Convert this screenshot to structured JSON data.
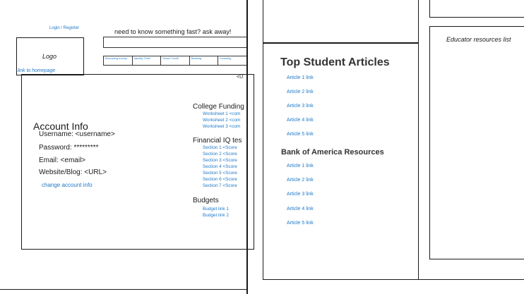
{
  "header": {
    "login": "Login / Register",
    "ask_label": "need to know something fast? ask away!",
    "logo": "Logo",
    "home_link": "link to homepage"
  },
  "nav": [
    {
      "label": "Borrowing money"
    },
    {
      "label": "Identity Theft"
    },
    {
      "label": "Smart Credit"
    },
    {
      "label": "Banking"
    },
    {
      "label": "Investing"
    }
  ],
  "url_tag": "<U",
  "account": {
    "heading": "Account Info",
    "username": "Username: <username>",
    "password": "Password: *********",
    "email": "Email: <email>",
    "website": "Website/Blog: <URL>",
    "change_link": "change account info"
  },
  "sections": {
    "college": {
      "title": "College Funding",
      "items": [
        "Worksheet 1 <com",
        "Worksheet 2 <com",
        "Worksheet 3 <com"
      ]
    },
    "financial": {
      "title": "Financial IQ tes",
      "items": [
        "Section 1 <Score",
        "Section 2 <Score",
        "Section 3 <Score",
        "Section 4 <Score",
        "Section 5 <Score",
        "Section 6 <Score",
        "Section 7 <Score"
      ]
    },
    "budgets": {
      "title": "Budgets",
      "items": [
        "Budget link 1",
        "Budget link 2"
      ]
    }
  },
  "top_articles": {
    "title": "Top Student Articles",
    "items": [
      "Article 1 link",
      "Article 2 link",
      "Article 3 link",
      "Article 4 link",
      "Article 5 link"
    ]
  },
  "boa": {
    "title": "Bank of America Resources",
    "items": [
      "Article 1 link",
      "Article 2 link",
      "Article 3 link",
      "Article 4 link",
      "Article 5 link"
    ]
  },
  "educator": {
    "title": "Educator resources list"
  }
}
